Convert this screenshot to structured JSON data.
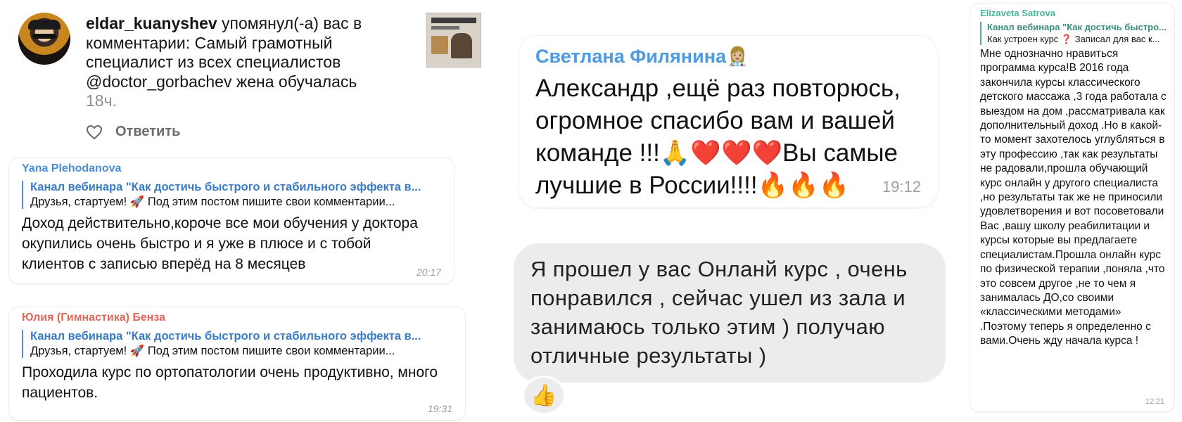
{
  "instagram": {
    "username": "eldar_kuanyshev",
    "message": " упомянул(-а) вас в комментарии: Самый грамотный специалист из всех специалистов @doctor_gorbachev жена обучалась ",
    "time": "18ч.",
    "reply_label": "Ответить"
  },
  "comments": [
    {
      "author": "Yana Plehodanova",
      "author_color": "#4a8fd4",
      "quote_title": "Канал вебинара \"Как достичь быстрого и стабильного эффекта в...",
      "quote_text": "Друзья, стартуем! 🚀  Под этим постом пишите свои комментарии...",
      "text": "Доход действительно,короче все мои обучения у доктора окупились очень быстро и я уже в плюсе и с тобой клиентов с записью вперёд на 8 месяцев",
      "time": "20:17"
    },
    {
      "author": "Юлия (Гимнастика) Бенза",
      "author_color": "#e0665a",
      "quote_title": "Канал вебинара \"Как достичь быстрого и стабильного эффекта в...",
      "quote_text": "Друзья, стартуем! 🚀  Под этим постом пишите свои комментарии...",
      "text": "Проходила курс по ортопатологии очень продуктивно, много пациентов.",
      "time": "19:31"
    }
  ],
  "svetlana": {
    "name": "Светлана Филянина",
    "name_emoji": "👩🏼‍⚕️",
    "text": "Александр ,ещё раз повторюсь, огромное спасибо вам и вашей команде !!!🙏❤️❤️❤️Вы самые лучшие в России!!!!🔥🔥🔥",
    "time": "19:12"
  },
  "review": {
    "text": "Я прошел у вас Онланй курс , очень понравился , сейчас ушел из зала и занимаюсь только этим ) получаю отличные результаты )",
    "reaction": "👍"
  },
  "elizaveta": {
    "name": "Elizaveta Satrova",
    "quote_title": "Канал вебинара \"Как достичь быстро...",
    "quote_text": "Как устроен курс ❓ Записал для вас к...",
    "text": "Мне  однозначно нравиться программа курса!В 2016 года закончила курсы классического детского массажа ,3 года работала с выездом на дом ,рассматривала как дополнительный доход .Но в какой-то момент захотелось углубляться в эту профессию ,так как результаты не радовали,прошла обучающий курс онлайн  у другого специалиста ,но результаты так же не приносили удовлетворения и вот посоветовали Вас ,вашу школу реабилитации и курсы которые вы предлагаете специалистам.Прошла онлайн курс по физической терапии ,поняла ,что это совсем другое ,не то чем я занималась ДО,со своими «классическими методами» .Поэтому теперь я определенно с вами.Очень жду начала курса !",
    "time": "12:21"
  }
}
